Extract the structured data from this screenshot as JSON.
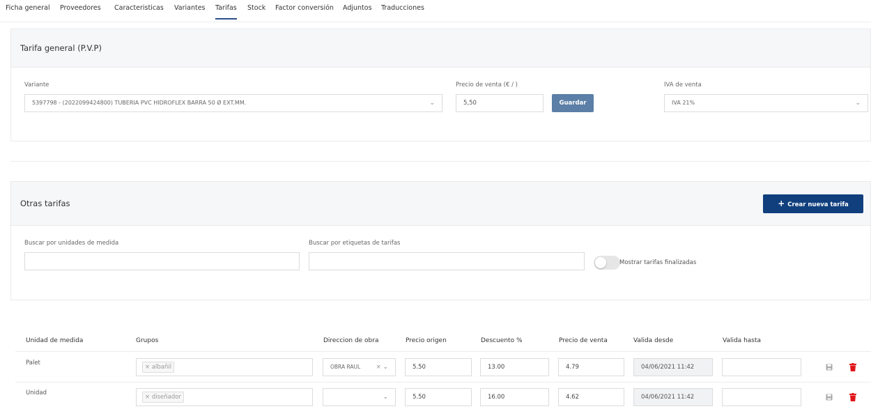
{
  "tabs": [
    {
      "label": "Ficha general",
      "active": false
    },
    {
      "label": "Proveedores",
      "active": false
    },
    {
      "label": "Caracteristicas",
      "active": false
    },
    {
      "label": "Variantes",
      "active": false
    },
    {
      "label": "Tarifas",
      "active": true
    },
    {
      "label": "Stock",
      "active": false
    },
    {
      "label": "Factor conversión",
      "active": false
    },
    {
      "label": "Adjuntos",
      "active": false
    },
    {
      "label": "Traducciones",
      "active": false
    }
  ],
  "tarifa_general": {
    "title": "Tarifa general (P.V.P)",
    "variante_label": "Variante",
    "variante_value": "5397798 - (2022099424800) TUBERIA PVC HIDROFLEX BARRA 50 Ø EXT.MM.",
    "precio_label": "Precio de venta (€ / )",
    "precio_value": "5,50",
    "guardar_label": "Guardar",
    "iva_label": "IVA de venta",
    "iva_value": "IVA 21%"
  },
  "otras_tarifas": {
    "title": "Otras tarifas",
    "crear_label": "Crear nueva tarifa",
    "buscar_unidades_label": "Buscar por unidades de medida",
    "buscar_etiquetas_label": "Buscar por etiquetas de tarifas",
    "mostrar_label": "Mostrar tarifas finalizadas",
    "mostrar_on": false
  },
  "table": {
    "headers": [
      "Unidad de medida",
      "Grupos",
      "Direccion de obra",
      "Precio origen",
      "Descuento %",
      "Precio de venta",
      "Valida desde",
      "Valida hasta"
    ],
    "rows": [
      {
        "unidad": "Palet",
        "grupo": "× albañil",
        "direccion": "OBRA RAUL",
        "direccion_clear": "×",
        "precio_origen": "5.50",
        "descuento": "13.00",
        "precio_venta": "4.79",
        "valida_desde": "04/06/2021 11:42",
        "valida_hasta": ""
      },
      {
        "unidad": "Unidad",
        "grupo": "× diseñador",
        "direccion": "",
        "direccion_clear": "",
        "precio_origen": "5.50",
        "descuento": "16.00",
        "precio_venta": "4.62",
        "valida_desde": "04/06/2021 11:42",
        "valida_hasta": ""
      }
    ]
  },
  "icons": {
    "save": "floppy-disk-icon",
    "delete": "trash-icon",
    "plus": "plus-icon",
    "chevron": "chevron-down-icon"
  },
  "colors": {
    "primary": "#113f7e",
    "guardar": "#5b7fa6",
    "delete": "#e0161b",
    "active_tab": "#2b4e8c"
  }
}
